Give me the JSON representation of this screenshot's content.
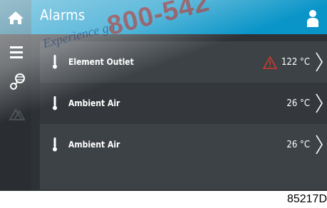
{
  "header": {
    "title": "Alarms",
    "home_icon": "home-icon",
    "user_icon": "user-icon"
  },
  "sidebar": {
    "items": [
      {
        "icon": "menu-icon"
      },
      {
        "icon": "network-icon"
      },
      {
        "icon": "warning-triangles-icon"
      }
    ]
  },
  "alarms": [
    {
      "label": "Element Outlet",
      "value": "122 °C",
      "warning": true
    },
    {
      "label": "Ambient Air",
      "value": "26 °C",
      "warning": false
    },
    {
      "label": "Ambient Air",
      "value": "26 °C",
      "warning": false
    }
  ],
  "caption": "85217D",
  "watermark": {
    "text_large": "800-542",
    "text_script": "Experience go"
  },
  "colors": {
    "topbar": "#0a95c8",
    "home_button": "#1d6f8e",
    "background": "#2e3236",
    "row_odd": "#3d4247",
    "row_even": "#34383c",
    "warning": "#d23a2a",
    "watermark_red": "#cc2a1f"
  }
}
